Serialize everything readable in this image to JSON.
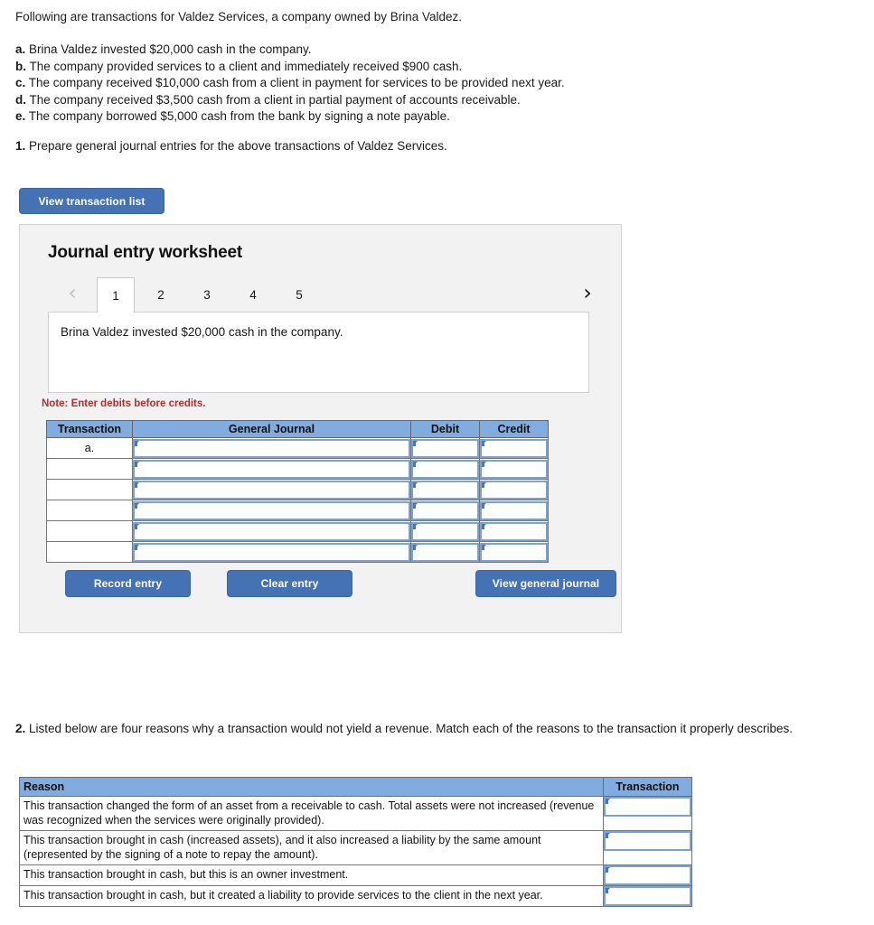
{
  "intro": "Following are transactions for Valdez Services, a company owned by Brina Valdez.",
  "transactions": [
    {
      "label": "a.",
      "text": "Brina Valdez invested $20,000 cash in the company."
    },
    {
      "label": "b.",
      "text": "The company provided services to a client and immediately received $900 cash."
    },
    {
      "label": "c.",
      "text": "The company received $10,000 cash from a client in payment for services to be provided next year."
    },
    {
      "label": "d.",
      "text": "The company received $3,500 cash from a client in partial payment of accounts receivable."
    },
    {
      "label": "e.",
      "text": "The company borrowed $5,000 cash from the bank by signing a note payable."
    }
  ],
  "requirement1": {
    "number": "1.",
    "text": "Prepare general journal entries for the above transactions of Valdez Services."
  },
  "view_transaction_list_label": "View transaction list",
  "worksheet": {
    "title": "Journal entry worksheet",
    "pager": {
      "prev_icon": "chevron-left",
      "next_icon": "chevron-right",
      "tabs": [
        "1",
        "2",
        "3",
        "4",
        "5"
      ],
      "active_tab": "1"
    },
    "description": "Brina Valdez invested $20,000 cash in the company.",
    "note": "Note: Enter debits before credits.",
    "columns": [
      "Transaction",
      "General Journal",
      "Debit",
      "Credit"
    ],
    "rows": [
      {
        "transaction": "a.",
        "general_journal": "",
        "debit": "",
        "credit": ""
      },
      {
        "transaction": "",
        "general_journal": "",
        "debit": "",
        "credit": ""
      },
      {
        "transaction": "",
        "general_journal": "",
        "debit": "",
        "credit": ""
      },
      {
        "transaction": "",
        "general_journal": "",
        "debit": "",
        "credit": ""
      },
      {
        "transaction": "",
        "general_journal": "",
        "debit": "",
        "credit": ""
      },
      {
        "transaction": "",
        "general_journal": "",
        "debit": "",
        "credit": ""
      }
    ],
    "buttons": {
      "record": "Record entry",
      "clear": "Clear entry",
      "view_journal": "View general journal"
    }
  },
  "requirement2": {
    "number": "2.",
    "text": "Listed below are four reasons why a transaction would not yield a revenue.  Match each of the reasons to the transaction it properly describes."
  },
  "reason_table": {
    "columns": [
      "Reason",
      "Transaction"
    ],
    "rows": [
      {
        "reason": "This transaction changed the form of an asset from a receivable to cash. Total assets were not increased (revenue was recognized when the services were originally provided).",
        "transaction": ""
      },
      {
        "reason": "This transaction brought in cash (increased assets), and it also increased a liability by the same amount (represented by the signing of a note to repay the amount).",
        "transaction": ""
      },
      {
        "reason": "This transaction brought in cash, but this is an owner investment.",
        "transaction": ""
      },
      {
        "reason": "This transaction brought in cash, but it created a liability to provide services to the client in the next year.",
        "transaction": ""
      }
    ]
  },
  "colors": {
    "header_blue": "#82abdf",
    "button_blue": "#4472b4",
    "note_red": "#b03030",
    "panel_bg": "#f2f2f2",
    "cell_border_blue": "#7ba2d4"
  }
}
